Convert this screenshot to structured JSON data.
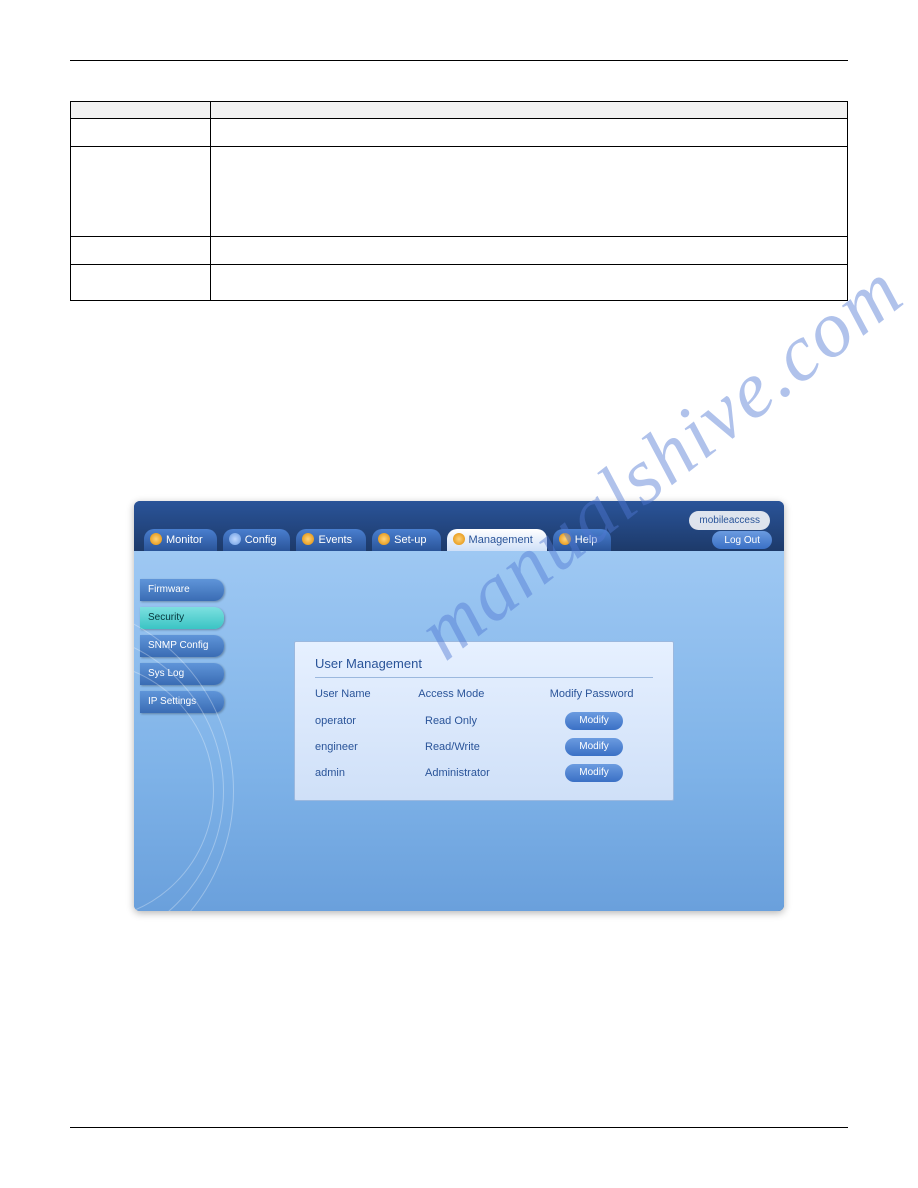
{
  "watermark": "manualshive.com",
  "nav_tabs": [
    {
      "label": "Monitor",
      "active": false
    },
    {
      "label": "Config",
      "active": false
    },
    {
      "label": "Events",
      "active": false
    },
    {
      "label": "Set-up",
      "active": false
    },
    {
      "label": "Management",
      "active": true
    },
    {
      "label": "Help",
      "active": false
    }
  ],
  "logout_label": "Log Out",
  "logo_text": "mobileaccess",
  "sidebar": {
    "items": [
      {
        "label": "Firmware",
        "active": false,
        "slug": "firmware"
      },
      {
        "label": "Security",
        "active": true,
        "slug": "security"
      },
      {
        "label": "SNMP Config",
        "active": false,
        "slug": "snmp-config"
      },
      {
        "label": "Sys Log",
        "active": false,
        "slug": "sys-log"
      },
      {
        "label": "IP Settings",
        "active": false,
        "slug": "ip-settings"
      }
    ]
  },
  "panel": {
    "title": "User Management",
    "columns": {
      "user": "User Name",
      "mode": "Access Mode",
      "pwd": "Modify Password"
    },
    "rows": [
      {
        "user": "operator",
        "mode": "Read Only",
        "btn": "Modify"
      },
      {
        "user": "engineer",
        "mode": "Read/Write",
        "btn": "Modify"
      },
      {
        "user": "admin",
        "mode": "Administrator",
        "btn": "Modify"
      }
    ]
  }
}
